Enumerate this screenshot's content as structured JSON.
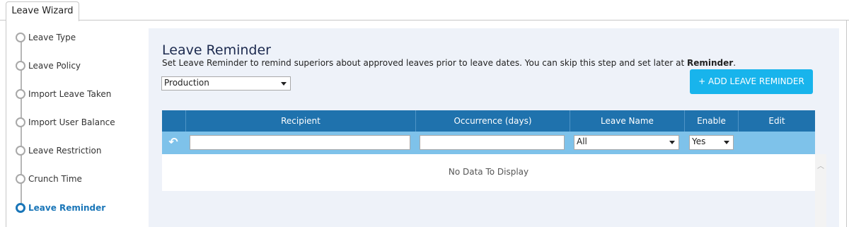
{
  "tab": {
    "label": "Leave Wizard"
  },
  "steps": [
    {
      "label": "Leave Type"
    },
    {
      "label": "Leave Policy"
    },
    {
      "label": "Import Leave Taken"
    },
    {
      "label": "Import User Balance"
    },
    {
      "label": "Leave Restriction"
    },
    {
      "label": "Crunch Time"
    },
    {
      "label": "Leave Reminder",
      "active": true
    }
  ],
  "main": {
    "title": "Leave Reminder",
    "description_prefix": "Set Leave Reminder to remind superiors about approved leaves prior to leave dates. You can skip this step and set later at ",
    "description_bold": "Reminder",
    "description_suffix": ".",
    "department_select": "Production",
    "add_button": "+ ADD LEAVE REMINDER"
  },
  "grid": {
    "columns": [
      "Recipient",
      "Occurrence (days)",
      "Leave Name",
      "Enable",
      "Edit"
    ],
    "filters": {
      "recipient": "",
      "occurrence": "",
      "leave_name": "All",
      "enable": "Yes"
    },
    "empty_text": "No Data To Display"
  },
  "colors": {
    "header": "#1f72ad",
    "filter_row": "#7ec2ea",
    "accent": "#18b4ec",
    "active_step": "#1a76b8"
  }
}
